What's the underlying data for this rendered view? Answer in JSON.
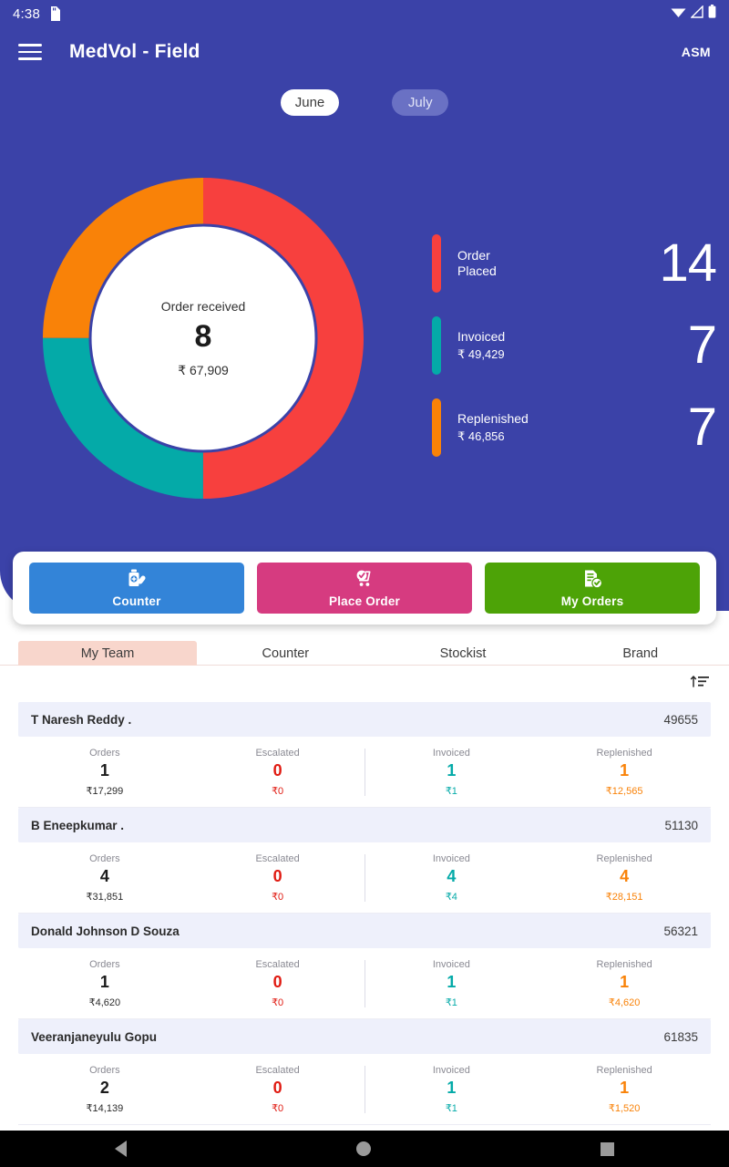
{
  "statusbar": {
    "time": "4:38",
    "sd_icon": "sd-card-icon",
    "wifi_icon": "wifi-icon",
    "signal_icon": "signal-icon",
    "battery_icon": "battery-icon"
  },
  "appbar": {
    "menu_icon": "hamburger-menu-icon",
    "title": "MedVol - Field",
    "role": "ASM"
  },
  "months": [
    {
      "label": "June",
      "selected": true
    },
    {
      "label": "July",
      "selected": false
    }
  ],
  "donut": {
    "center_label": "Order received",
    "center_count": "8",
    "center_amount": "₹ 67,909"
  },
  "legend": [
    {
      "name_line1": "Order",
      "name_line2": "Placed",
      "amount": "",
      "count": "14",
      "color": "#f7403e"
    },
    {
      "name_line1": "Invoiced",
      "name_line2": "",
      "amount": "₹ 49,429",
      "count": "7",
      "color": "#04aaa8"
    },
    {
      "name_line1": "Replenished",
      "name_line2": "",
      "amount": "₹ 46,856",
      "count": "7",
      "color": "#f98208"
    }
  ],
  "actions": [
    {
      "label": "Counter",
      "color": "#3384d8",
      "icon": "medicine-bottle-icon"
    },
    {
      "label": "Place Order",
      "color": "#d63b80",
      "icon": "shopping-cart-check-icon"
    },
    {
      "label": "My Orders",
      "color": "#4da307",
      "icon": "document-check-icon"
    }
  ],
  "tabs": [
    {
      "label": "My Team",
      "active": true
    },
    {
      "label": "Counter",
      "active": false
    },
    {
      "label": "Stockist",
      "active": false
    },
    {
      "label": "Brand",
      "active": false
    }
  ],
  "sort": {
    "icon": "sort-ascending-icon"
  },
  "stat_labels": {
    "orders": "Orders",
    "escalated": "Escalated",
    "invoiced": "Invoiced",
    "replenished": "Replenished"
  },
  "people": [
    {
      "name": "T Naresh Reddy .",
      "code": "49655",
      "orders_value": "1",
      "orders_amount": "₹17,299",
      "escalated_value": "0",
      "escalated_amount": "₹0",
      "invoiced_value": "1",
      "invoiced_amount": "₹1",
      "replenished_value": "1",
      "replenished_amount": "₹12,565"
    },
    {
      "name": "B Eneepkumar .",
      "code": "51130",
      "orders_value": "4",
      "orders_amount": "₹31,851",
      "escalated_value": "0",
      "escalated_amount": "₹0",
      "invoiced_value": "4",
      "invoiced_amount": "₹4",
      "replenished_value": "4",
      "replenished_amount": "₹28,151"
    },
    {
      "name": "Donald Johnson D Souza",
      "code": "56321",
      "orders_value": "1",
      "orders_amount": "₹4,620",
      "escalated_value": "0",
      "escalated_amount": "₹0",
      "invoiced_value": "1",
      "invoiced_amount": "₹1",
      "replenished_value": "1",
      "replenished_amount": "₹4,620"
    },
    {
      "name": "Veeranjaneyulu Gopu",
      "code": "61835",
      "orders_value": "2",
      "orders_amount": "₹14,139",
      "escalated_value": "0",
      "escalated_amount": "₹0",
      "invoiced_value": "1",
      "invoiced_amount": "₹1",
      "replenished_value": "1",
      "replenished_amount": "₹1,520"
    }
  ],
  "navbar": {
    "back_icon": "back-triangle-icon",
    "home_icon": "home-circle-icon",
    "recent_icon": "recents-square-icon"
  },
  "colors": {
    "brand_blue": "#3b42a8",
    "order_placed": "#f7403e",
    "invoiced": "#04aaa8",
    "replenished": "#f98208",
    "escalated_red": "#e01b12",
    "orders_dark": "#1b1b1b",
    "tab_active_bg": "#f8d6cc"
  },
  "chart_data": {
    "type": "pie",
    "title": "Order received",
    "labels": [
      "Order Placed",
      "Invoiced",
      "Replenished"
    ],
    "values": [
      14,
      7,
      7
    ],
    "amounts": [
      "₹ 49,429",
      "₹ 46,856"
    ],
    "colors": [
      "#f7403e",
      "#04aaa8",
      "#f98208"
    ],
    "center_total_count": 8,
    "center_total_amount": "₹ 67,909",
    "donut": true,
    "legend_position": "right",
    "start_angle_deg": 0,
    "direction": "clockwise"
  }
}
